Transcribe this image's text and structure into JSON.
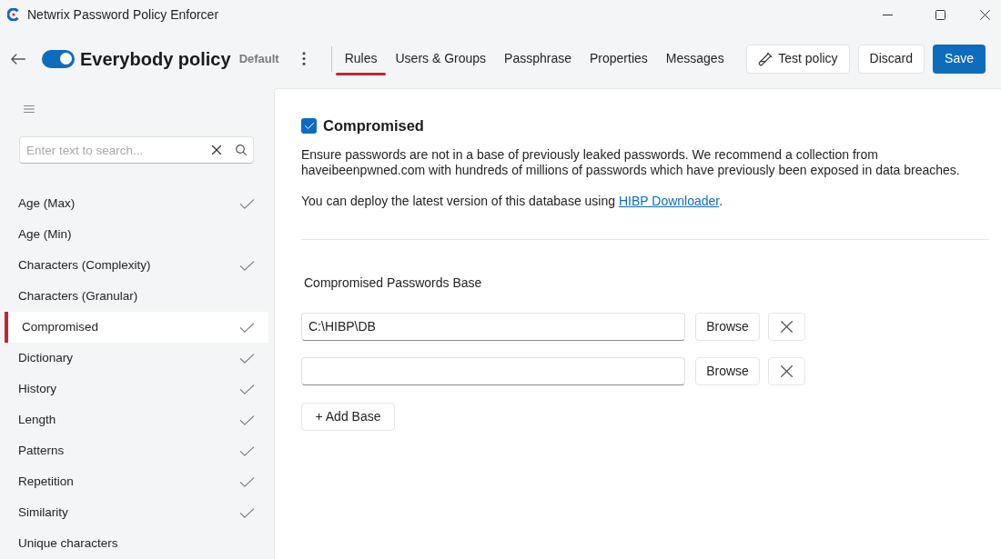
{
  "window": {
    "title": "Netwrix Password Policy Enforcer"
  },
  "header": {
    "enabled": true,
    "policy_name": "Everybody policy",
    "badge": "Default"
  },
  "tabs": [
    {
      "label": "Rules",
      "selected": true
    },
    {
      "label": "Users & Groups",
      "selected": false
    },
    {
      "label": "Passphrase",
      "selected": false
    },
    {
      "label": "Properties",
      "selected": false
    },
    {
      "label": "Messages",
      "selected": false
    }
  ],
  "actions": [
    {
      "label": "Test policy",
      "kind": "test"
    },
    {
      "label": "Discard",
      "kind": "secondary"
    },
    {
      "label": "Save",
      "kind": "primary"
    }
  ],
  "sidebar": {
    "search": {
      "placeholder": "Enter text to search..."
    },
    "items": [
      {
        "label": "Age (Max)",
        "checked": true,
        "selected": false
      },
      {
        "label": "Age (Min)",
        "checked": false,
        "selected": false
      },
      {
        "label": "Characters (Complexity)",
        "checked": true,
        "selected": false
      },
      {
        "label": "Characters (Granular)",
        "checked": false,
        "selected": false
      },
      {
        "label": "Compromised",
        "checked": true,
        "selected": true
      },
      {
        "label": "Dictionary",
        "checked": true,
        "selected": false
      },
      {
        "label": "History",
        "checked": true,
        "selected": false
      },
      {
        "label": "Length",
        "checked": true,
        "selected": false
      },
      {
        "label": "Patterns",
        "checked": true,
        "selected": false
      },
      {
        "label": "Repetition",
        "checked": true,
        "selected": false
      },
      {
        "label": "Similarity",
        "checked": true,
        "selected": false
      },
      {
        "label": "Unique characters",
        "checked": false,
        "selected": false
      }
    ]
  },
  "rule": {
    "title": "Compromised",
    "enabled": true,
    "description": "Ensure passwords are not in a base of previously leaked passwords. We recommend a collection from haveibeenpwned.com with hundreds of millions of passwords which have previously been exposed in data breaches.",
    "deploy": {
      "before": "You can deploy the latest version of this database using",
      "link": "HIBP Downloader",
      "after": "."
    }
  },
  "bases": {
    "label": "Compromised Passwords Base",
    "rows": [
      {
        "value": "C:\\HIBP\\DB",
        "button": "Browse"
      },
      {
        "button": "Browse"
      }
    ],
    "add_button": "+ Add Base"
  }
}
